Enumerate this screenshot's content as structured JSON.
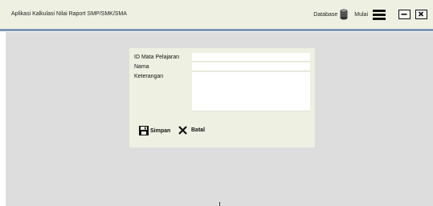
{
  "app": {
    "title": "Aplikasi Kalkulasi Nilai Raport SMP/SMK/SMA"
  },
  "topbar": {
    "database_label": "Database",
    "mulai_label": "Mulai",
    "database_icon": "database-icon",
    "menu_icon": "hamburger-menu-icon",
    "minimize_icon": "minimize-icon",
    "close_icon": "close-icon"
  },
  "form": {
    "id_label": "ID Mata Pelajaran",
    "id_value": "",
    "nama_label": "Nama",
    "nama_value": "",
    "keterangan_label": "Keterangan",
    "keterangan_value": "",
    "save_label": "Simpan",
    "save_icon": "floppy-save-icon",
    "cancel_label": "Batal",
    "cancel_icon": "x-cancel-icon"
  },
  "colors": {
    "titlebar_bg": "#eef0e2",
    "accent_line": "#7c96b4",
    "workspace_bg": "#dddddd",
    "panel_bg": "#eef0e2"
  }
}
